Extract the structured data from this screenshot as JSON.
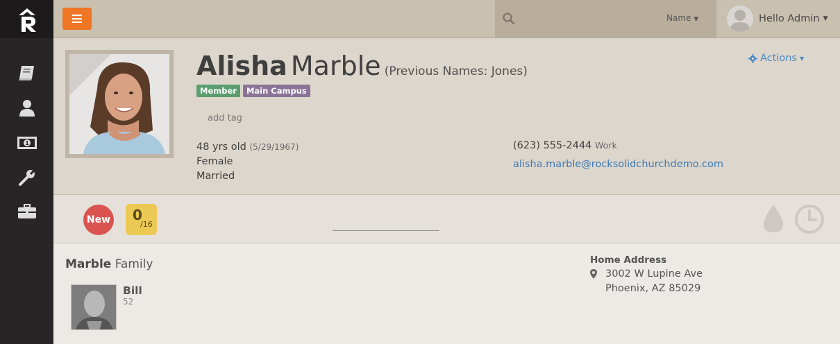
{
  "topbar": {
    "search": {
      "placeholder": "",
      "type_label": "Name"
    },
    "user": {
      "greeting": "Hello Admin"
    }
  },
  "sidebar": {
    "items": [
      {
        "icon": "book-icon"
      },
      {
        "icon": "user-icon"
      },
      {
        "icon": "money-icon"
      },
      {
        "icon": "wrench-icon"
      },
      {
        "icon": "briefcase-icon"
      }
    ]
  },
  "person": {
    "first_name": "Alisha",
    "last_name": "Marble",
    "previous_names": "(Previous Names: Jones)",
    "badges": [
      {
        "label": "Member",
        "color": "#5a9e6f"
      },
      {
        "label": "Main Campus",
        "color": "#8a7396"
      }
    ],
    "add_tag": "add tag",
    "age": "48 yrs old",
    "birthdate": "(5/29/1967)",
    "gender": "Female",
    "marital_status": "Married",
    "phone": "(623) 555-2444",
    "phone_type": "Work",
    "email": "alisha.marble@rocksolidchurchdemo.com",
    "actions_label": "Actions"
  },
  "badge_bar": {
    "new_label": "New",
    "count_value": "0",
    "count_total": "/16",
    "underline": "______________________"
  },
  "family": {
    "name": "Marble",
    "suffix": "Family",
    "members": [
      {
        "name": "Bill",
        "age": "52"
      }
    ],
    "address_title": "Home Address",
    "address_line1": "3002 W Lupine Ave",
    "address_line2": "Phoenix, AZ 85029"
  },
  "colors": {
    "accent_orange": "#ee7625",
    "link_blue": "#3c7ab5",
    "new_red": "#d9534f",
    "count_yellow": "#ecc955"
  }
}
